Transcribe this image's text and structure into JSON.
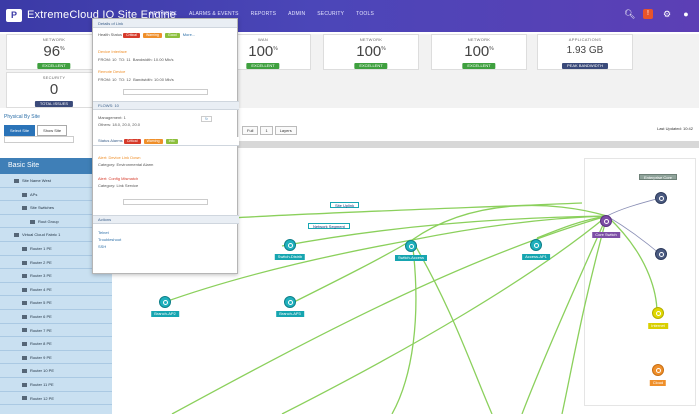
{
  "header": {
    "logo": "P",
    "brand": "ExtremeCloud IQ Site Engine",
    "nav": [
      "NETWORK",
      "ALARMS & EVENTS",
      "REPORTS",
      "ADMIN",
      "SECURITY",
      "TOOLS"
    ],
    "icons": [
      "search-icon",
      "warning-icon",
      "settings-icon",
      "user-icon"
    ]
  },
  "metrics": [
    {
      "title": "NETWORK",
      "value": "96",
      "unit": "%",
      "badge": "EXCELLENT",
      "badge_color": "#3fa03f"
    },
    {
      "title": "SECURITY",
      "value": "0",
      "unit": "",
      "badge": "TOTAL ISSUES",
      "badge_color": "#3a4a7a"
    },
    {
      "title": "WAN",
      "value": "100",
      "unit": "%",
      "badge": "EXCELLENT",
      "badge_color": "#3fa03f"
    },
    {
      "title": "NETWORK",
      "value": "100",
      "unit": "%",
      "badge": "EXCELLENT",
      "badge_color": "#3fa03f"
    },
    {
      "title": "NETWORK",
      "value": "100",
      "unit": "%",
      "badge": "EXCELLENT",
      "badge_color": "#3fa03f"
    },
    {
      "title": "APPLICATIONS",
      "value": "1.93 GB",
      "unit": "",
      "badge": "PEAK BANDWIDTH",
      "badge_color": "#3a4a7a"
    }
  ],
  "sidebar": {
    "title": "Physical By Site",
    "tabs": [
      "Select Site",
      "Show Site"
    ],
    "header": "Basic Site",
    "items": [
      "Site Name West",
      "APs",
      "Site Switches",
      "Rout Group",
      "Virtual Cloud Fabric 1",
      "Router 1 PE",
      "Router 2 PE",
      "Router 3 PE",
      "Router 4 PE",
      "Router 5 PE",
      "Router 6 PE",
      "Router 7 PE",
      "Router 8 PE",
      "Router 9 PE",
      "Router 10 PE",
      "Router 11 PE",
      "Router 12 PE"
    ]
  },
  "panel": {
    "title": "Details of Link",
    "sections": {
      "health": "Health Status",
      "pills": [
        "Critical",
        "Warning",
        "Good"
      ],
      "more": "More...",
      "local_label": "Device Interface",
      "local_vals": [
        "FROM: 10",
        "TO: 11",
        "Bandwidth: 10.00 Mb/s"
      ],
      "remote_label": "Remote Device",
      "remote_vals": [
        "FROM: 10",
        "TO: 12",
        "Bandwidth: 10.00 Mb/s"
      ],
      "flows": "FLOWS: 10",
      "mgmt": "Management: 1",
      "mgmt_sub": "Others: 18.0, 20.0, 20.0",
      "status_title": "Status Alarms",
      "alarm_pills": [
        "Critical",
        "Warning",
        "Info"
      ],
      "alarm1": "Alert: Device Link Down",
      "alarm1_sub": "Category: Environmental Alarm",
      "alarm2": "Alert: Config Mismatch",
      "alarm2_sub": "Category: Link Service",
      "actions": "Actions",
      "action_items": [
        "Telnet",
        "Troubleshoot",
        "SSH"
      ]
    }
  },
  "canvas": {
    "toolbar": [
      "Full",
      "1",
      "Layers"
    ],
    "right_note": "Last Updated: 10:42",
    "tags": [
      "Site Uplink",
      "Network Segment",
      "Enterprise Core"
    ],
    "nodes": [
      "Switch-Distrib",
      "Switch-Access",
      "Access-AP1",
      "Branch-AP2",
      "Branch-AP3",
      "Switch-A4",
      "Switch-A5",
      "Internet",
      "Core Switch",
      "Cloud"
    ]
  },
  "colors": {
    "accent": "#3b3aa6",
    "teal": "#1fb0bd",
    "link": "#8bd05c",
    "purple": "#7d4ea6",
    "yellow": "#e0d800",
    "orange": "#ef8f2a"
  }
}
